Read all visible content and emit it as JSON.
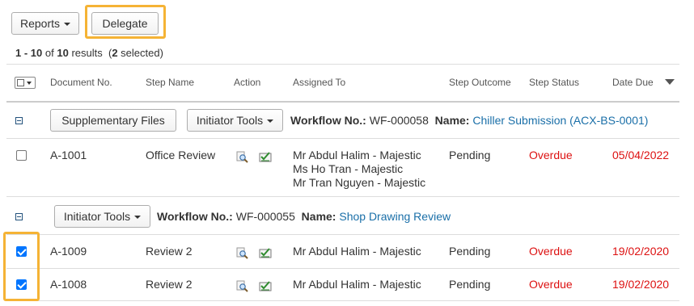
{
  "toolbar": {
    "reports_label": "Reports",
    "delegate_label": "Delegate"
  },
  "summary": {
    "range": "1 - 10",
    "of_text": "of",
    "total": "10",
    "results_text": "results",
    "selected_prefix": "(",
    "selected_count": "2",
    "selected_suffix": "selected)"
  },
  "columns": {
    "document_no": "Document No.",
    "step_name": "Step Name",
    "action": "Action",
    "assigned_to": "Assigned To",
    "step_outcome": "Step Outcome",
    "step_status": "Step Status",
    "date_due": "Date Due"
  },
  "groups": [
    {
      "supplementary_label": "Supplementary Files",
      "initiator_label": "Initiator Tools",
      "workflow_label": "Workflow No.:",
      "workflow_no": "WF-000058",
      "name_label": "Name:",
      "name_value": "Chiller Submission (ACX-BS-0001)",
      "rows": [
        {
          "checked": false,
          "document_no": "A-1001",
          "step_name": "Office Review",
          "assigned": [
            "Mr Abdul Halim - Majestic",
            "Ms Ho Tran - Majestic",
            "Mr Tran Nguyen - Majestic"
          ],
          "outcome": "Pending",
          "status": "Overdue",
          "date_due": "05/04/2022"
        }
      ]
    },
    {
      "initiator_label": "Initiator Tools",
      "workflow_label": "Workflow No.:",
      "workflow_no": "WF-000055",
      "name_label": "Name:",
      "name_value": "Shop Drawing Review",
      "rows": [
        {
          "checked": true,
          "document_no": "A-1009",
          "step_name": "Review 2",
          "assigned": [
            "Mr Abdul Halim - Majestic"
          ],
          "outcome": "Pending",
          "status": "Overdue",
          "date_due": "19/02/2020"
        },
        {
          "checked": true,
          "document_no": "A-1008",
          "step_name": "Review 2",
          "assigned": [
            "Mr Abdul Halim - Majestic"
          ],
          "outcome": "Pending",
          "status": "Overdue",
          "date_due": "19/02/2020"
        }
      ]
    }
  ],
  "colors": {
    "highlight": "#f5b335",
    "overdue": "#dd1111",
    "link": "#1a6fa8",
    "checkbox": "#0075ff"
  },
  "icons": [
    "view-icon",
    "approve-icon",
    "sort-desc-icon",
    "collapse-icon"
  ]
}
